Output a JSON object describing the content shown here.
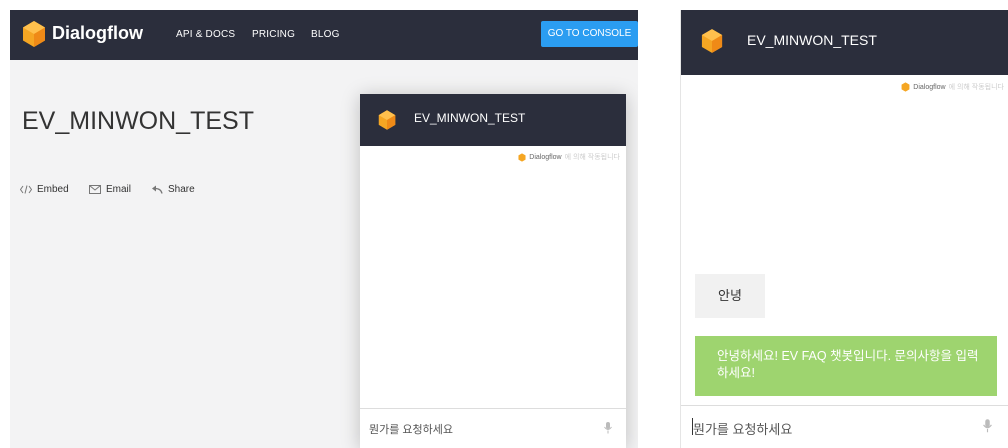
{
  "header": {
    "brand": "Dialogflow",
    "nav": [
      "API & DOCS",
      "PRICING",
      "BLOG"
    ],
    "console_button": "GO TO CONSOLE"
  },
  "agent": {
    "title": "EV_MINWON_TEST",
    "actions": {
      "embed": "Embed",
      "email": "Email",
      "share": "Share"
    }
  },
  "widget": {
    "title": "EV_MINWON_TEST",
    "powered_brand": "Dialogflow",
    "powered_suffix": "에 의해 작동됩니다",
    "input_placeholder": "뭔가를 요청하세요"
  },
  "chat": {
    "title": "EV_MINWON_TEST",
    "powered_brand": "Dialogflow",
    "powered_suffix": "에 의해 작동됩니다",
    "user_message": "안녕",
    "bot_message": "안녕하세요! EV FAQ 챗봇입니다. 문의사항을 입력하세요!",
    "input_placeholder": "뭔가를 요청하세요"
  },
  "colors": {
    "header_bg": "#2b2e3c",
    "console_button": "#2b9df1",
    "logo_orange": "#f5a623",
    "bot_bubble": "#9ed46f",
    "page_bg": "#f3f3f4"
  }
}
